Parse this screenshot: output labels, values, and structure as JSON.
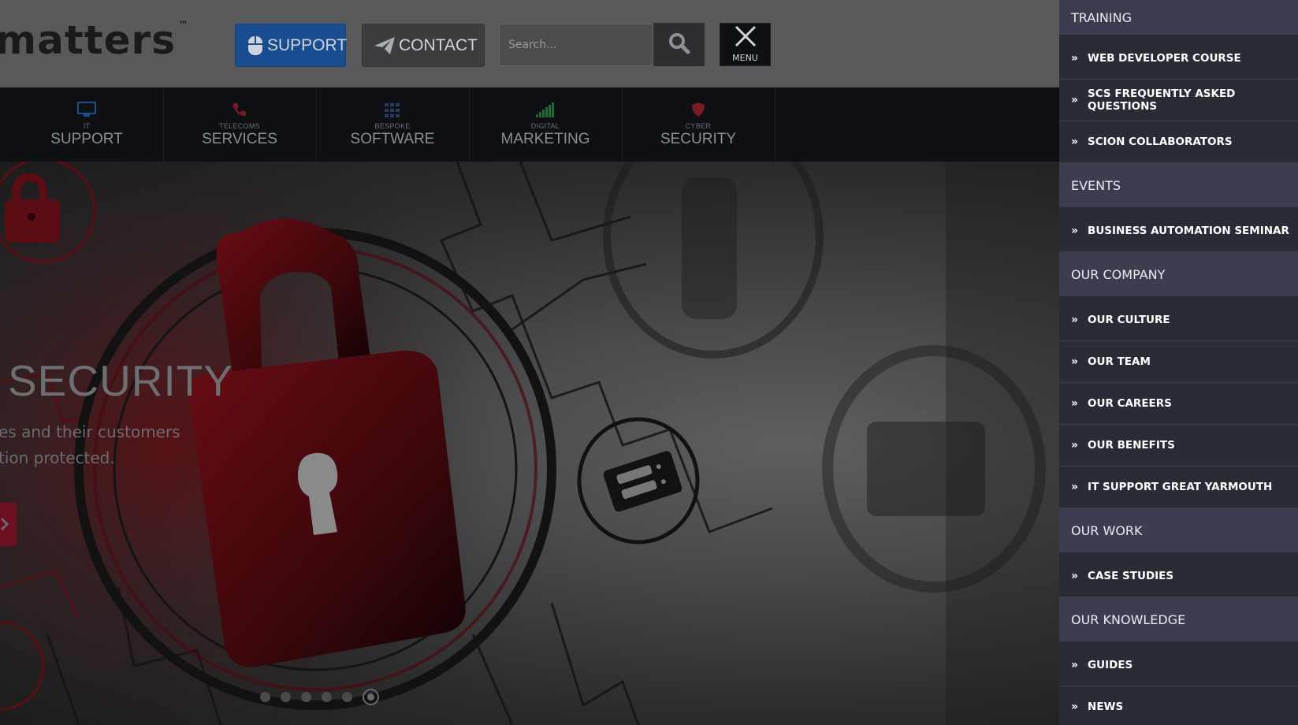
{
  "header": {
    "logo_text": "matters",
    "logo_mark": "™",
    "support_button": "SUPPORT",
    "contact_button": "CONTACT",
    "search_placeholder": "Search...",
    "menu_label": "MENU"
  },
  "nav": [
    {
      "small": "IT",
      "big": "SUPPORT",
      "icon": "monitor-icon",
      "color": "#1f4f8f"
    },
    {
      "small": "TELECOMS",
      "big": "SERVICES",
      "icon": "phone-icon",
      "color": "#7a1a24"
    },
    {
      "small": "BESPOKE",
      "big": "SOFTWARE",
      "icon": "grid-icon",
      "color": "#2a3a66"
    },
    {
      "small": "DIGITAL",
      "big": "MARKETING",
      "icon": "signal-icon",
      "color": "#1f6a33"
    },
    {
      "small": "CYBER",
      "big": "SECURITY",
      "icon": "shield-icon",
      "color": "#7a1a24"
    }
  ],
  "hero": {
    "title": "SECURITY",
    "subtitle_line1": "es and their customers",
    "subtitle_line2": "tion protected.",
    "slide_count": 6,
    "active_slide": 6
  },
  "sidebar": {
    "training": "TRAINING",
    "training_items": [
      "WEB DEVELOPER COURSE",
      "SCS FREQUENTLY ASKED QUESTIONS",
      "SCION COLLABORATORS"
    ],
    "events": "EVENTS",
    "events_items": [
      "BUSINESS AUTOMATION SEMINAR"
    ],
    "company": "OUR COMPANY",
    "company_items": [
      "OUR CULTURE",
      "OUR TEAM",
      "OUR CAREERS",
      "OUR BENEFITS",
      "IT SUPPORT GREAT YARMOUTH"
    ],
    "work": "OUR WORK",
    "work_items": [
      "CASE STUDIES"
    ],
    "knowledge": "OUR KNOWLEDGE",
    "knowledge_items": [
      "GUIDES",
      "NEWS"
    ],
    "bullet": "»"
  },
  "colors": {
    "support_blue": "#1a4d8f",
    "sidebar_section": "#3b3e4f",
    "sidebar_bg": "#2a2c35",
    "hero_arrow": "#6e0f22"
  }
}
